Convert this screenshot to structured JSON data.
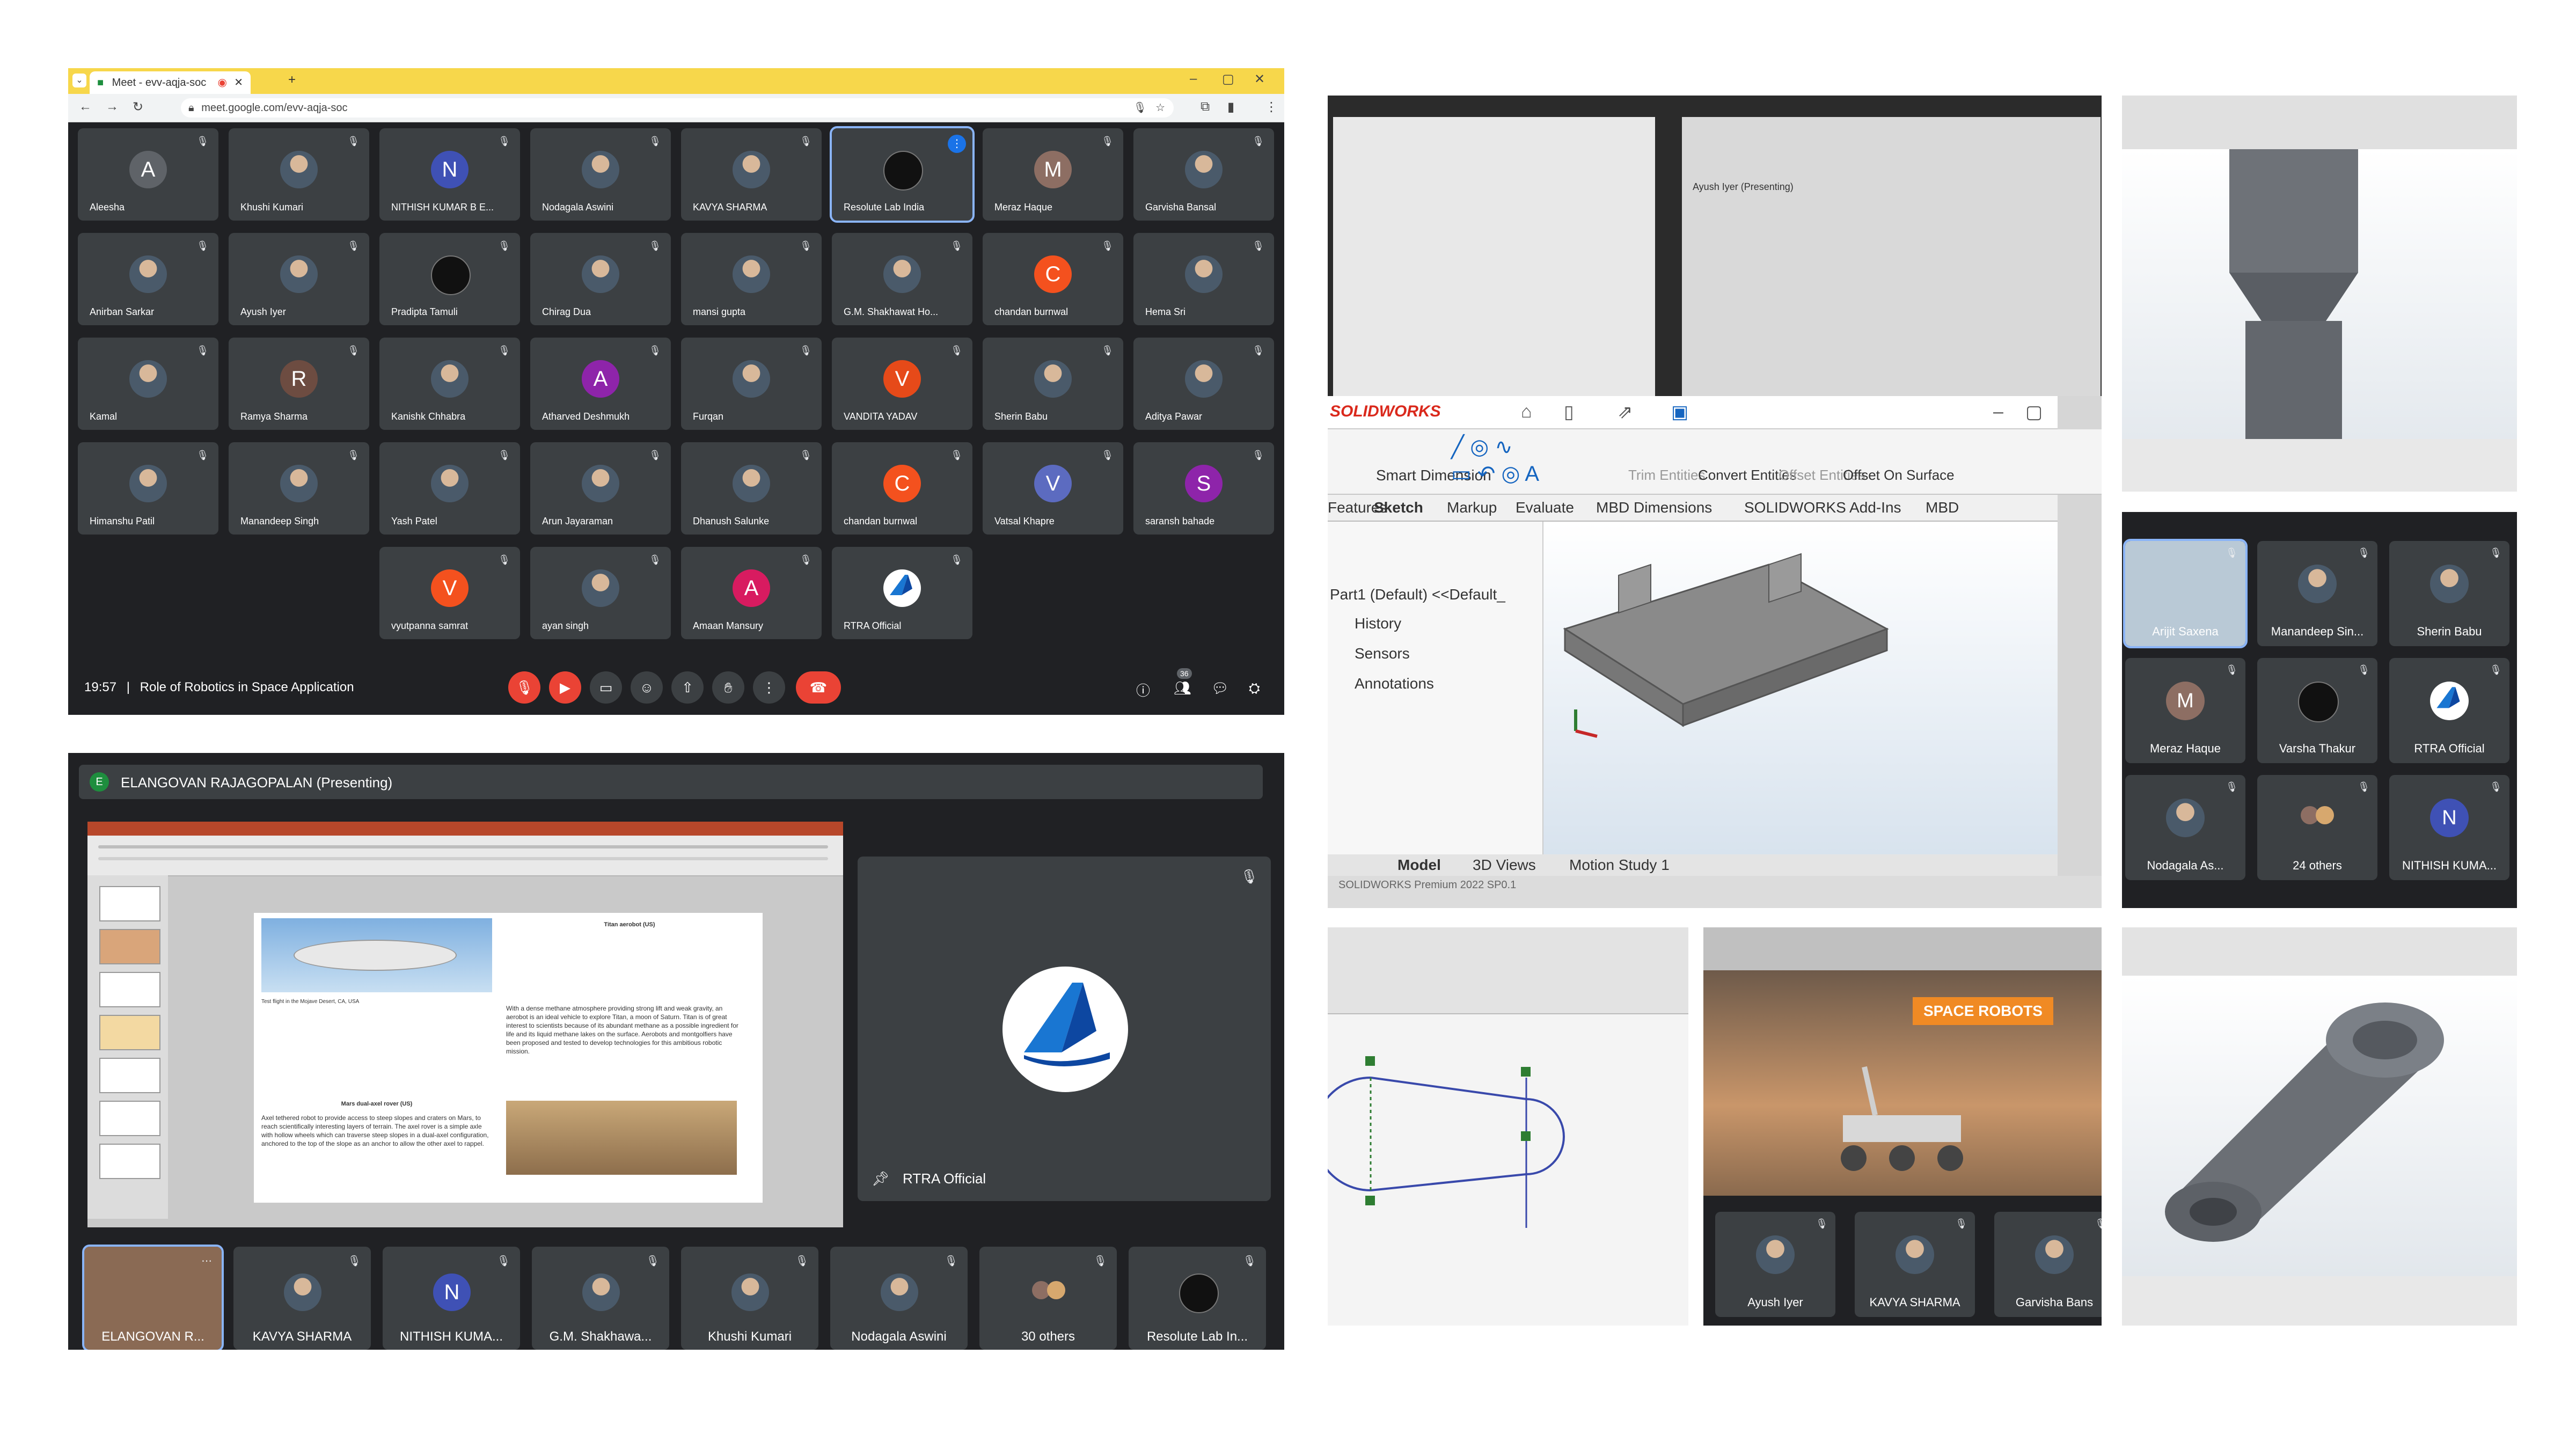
{
  "browser": {
    "tab_title": "Meet - evv-aqja-soc",
    "url": "meet.google.com/evv-aqja-soc"
  },
  "meet_grid": {
    "tiles": [
      {
        "name": "Aleesha",
        "initial": "A",
        "color": "#5f6368"
      },
      {
        "name": "Khushi Kumari",
        "initial": "",
        "color": "photo"
      },
      {
        "name": "NITHISH KUMAR B E...",
        "initial": "N",
        "color": "#3f51b5"
      },
      {
        "name": "Nodagala Aswini",
        "initial": "",
        "color": "photo"
      },
      {
        "name": "KAVYA SHARMA",
        "initial": "",
        "color": "photo"
      },
      {
        "name": "Resolute Lab India",
        "initial": "",
        "color": "dark",
        "speaking": true
      },
      {
        "name": "Meraz Haque",
        "initial": "M",
        "color": "#8d6e63"
      },
      {
        "name": "Garvisha Bansal",
        "initial": "",
        "color": "photo"
      },
      {
        "name": "Anirban Sarkar",
        "initial": "",
        "color": "photo"
      },
      {
        "name": "Ayush Iyer",
        "initial": "",
        "color": "photo"
      },
      {
        "name": "Pradipta Tamuli",
        "initial": "",
        "color": "dark"
      },
      {
        "name": "Chirag Dua",
        "initial": "",
        "color": "photo"
      },
      {
        "name": "mansi gupta",
        "initial": "",
        "color": "photo"
      },
      {
        "name": "G.M. Shakhawat Ho...",
        "initial": "",
        "color": "photo"
      },
      {
        "name": "chandan burnwal",
        "initial": "C",
        "color": "#f4511e"
      },
      {
        "name": "Hema Sri",
        "initial": "",
        "color": "photo"
      },
      {
        "name": "Kamal",
        "initial": "",
        "color": "photo"
      },
      {
        "name": "Ramya Sharma",
        "initial": "R",
        "color": "#6d4c41"
      },
      {
        "name": "Kanishk Chhabra",
        "initial": "",
        "color": "photo"
      },
      {
        "name": "Atharved Deshmukh",
        "initial": "A",
        "color": "#8e24aa"
      },
      {
        "name": "Furqan",
        "initial": "",
        "color": "photo"
      },
      {
        "name": "VANDITA YADAV",
        "initial": "V",
        "color": "#e64a19"
      },
      {
        "name": "Sherin Babu",
        "initial": "",
        "color": "photo"
      },
      {
        "name": "Aditya Pawar",
        "initial": "",
        "color": "photo"
      },
      {
        "name": "Himanshu Patil",
        "initial": "",
        "color": "photo"
      },
      {
        "name": "Manandeep Singh",
        "initial": "",
        "color": "photo"
      },
      {
        "name": "Yash Patel",
        "initial": "",
        "color": "photo"
      },
      {
        "name": "Arun Jayaraman",
        "initial": "",
        "color": "photo"
      },
      {
        "name": "Dhanush Salunke",
        "initial": "",
        "color": "photo"
      },
      {
        "name": "chandan burnwal",
        "initial": "C",
        "color": "#f4511e"
      },
      {
        "name": "Vatsal Khapre",
        "initial": "V",
        "color": "#5c6bc0"
      },
      {
        "name": "saransh bahade",
        "initial": "S",
        "color": "#8e24aa"
      },
      {
        "name": "vyutpanna samrat",
        "initial": "V",
        "color": "#f4511e"
      },
      {
        "name": "ayan singh",
        "initial": "",
        "color": "photo"
      },
      {
        "name": "Amaan Mansury",
        "initial": "A",
        "color": "#d81b60"
      },
      {
        "name": "RTRA Official",
        "initial": "",
        "color": "rtra"
      }
    ],
    "bottom_bar": {
      "time": "19:57",
      "meeting_title": "Role of Robotics in Space Application",
      "people_count": "36"
    }
  },
  "presenting": {
    "presenter_initial": "E",
    "presenter_label": "ELANGOVAN RAJAGOPALAN (Presenting)",
    "pinned_tile_name": "RTRA Official",
    "slide": {
      "heading_right": "Titan aerobot (US)",
      "caption_left": "Test flight in the Mojave Desert, CA, USA",
      "heading_lower": "Mars dual-axel rover (US)",
      "body_right": "With a dense methane atmosphere providing strong lift and weak gravity, an aerobot is an ideal vehicle to explore Titan, a moon of Saturn. Titan is of great interest to scientists because of its abundant methane as a possible ingredient for life and its liquid methane lakes on the surface. Aerobots and montgolfiers have been proposed and tested to develop technologies for this ambitious robotic mission.",
      "body_left": "Axel tethered robot to provide access to steep slopes and craters on Mars, to reach scientifically interesting layers of terrain. The axel rover is a simple axle with hollow wheels which can traverse steep slopes in a dual-axel configuration, anchored to the top of the slope as an anchor to allow the other axel to rappel."
    },
    "strip": [
      {
        "name": "ELANGOVAN R...",
        "initial": "",
        "color": "photo"
      },
      {
        "name": "KAVYA SHARMA",
        "initial": "",
        "color": "photo"
      },
      {
        "name": "NITHISH KUMA...",
        "initial": "N",
        "color": "#3f51b5"
      },
      {
        "name": "G.M. Shakhawa...",
        "initial": "",
        "color": "photo"
      },
      {
        "name": "Khushi Kumari",
        "initial": "",
        "color": "photo"
      },
      {
        "name": "Nodagala Aswini",
        "initial": "",
        "color": "photo"
      },
      {
        "name": "30 others",
        "initial": "",
        "color": "group"
      },
      {
        "name": "Resolute Lab In...",
        "initial": "",
        "color": "dark"
      }
    ]
  },
  "solidworks": {
    "brand": "SOLIDWORKS",
    "presenting_label": "Ayush Iyer (Presenting)",
    "commands": [
      "Smart Dimension",
      "Trim Entities",
      "Convert Entities",
      "Offset Entities",
      "Offset On Surface"
    ],
    "tabs": [
      "Features",
      "Sketch",
      "Markup",
      "Evaluate",
      "MBD Dimensions",
      "SOLIDWORKS Add-Ins",
      "MBD"
    ],
    "tree": [
      "Part1 (Default) <<Default_",
      "History",
      "Sensors",
      "Annotations"
    ],
    "bottom_tabs": [
      "Model",
      "3D Views",
      "Motion Study 1"
    ],
    "status": "SOLIDWORKS Premium 2022 SP0.1"
  },
  "side_grid": {
    "tiles": [
      {
        "name": "Arijit Saxena",
        "initial": "",
        "color": "photo",
        "speaking": true
      },
      {
        "name": "Manandeep Sin...",
        "initial": "",
        "color": "photo"
      },
      {
        "name": "Sherin Babu",
        "initial": "",
        "color": "photo"
      },
      {
        "name": "Meraz Haque",
        "initial": "M",
        "color": "#8d6e63"
      },
      {
        "name": "Varsha Thakur",
        "initial": "",
        "color": "dark"
      },
      {
        "name": "RTRA Official",
        "initial": "",
        "color": "rtra"
      },
      {
        "name": "Nodagala As...",
        "initial": "",
        "color": "photo"
      },
      {
        "name": "24 others",
        "initial": "",
        "color": "group"
      },
      {
        "name": "NITHISH KUMA...",
        "initial": "N",
        "color": "#3f51b5"
      }
    ]
  },
  "robot_slide": {
    "banner": "SPACE ROBOTS",
    "tiles": [
      {
        "name": "Ayush Iyer"
      },
      {
        "name": "KAVYA SHARMA"
      },
      {
        "name": "Garvisha Bans"
      }
    ]
  }
}
